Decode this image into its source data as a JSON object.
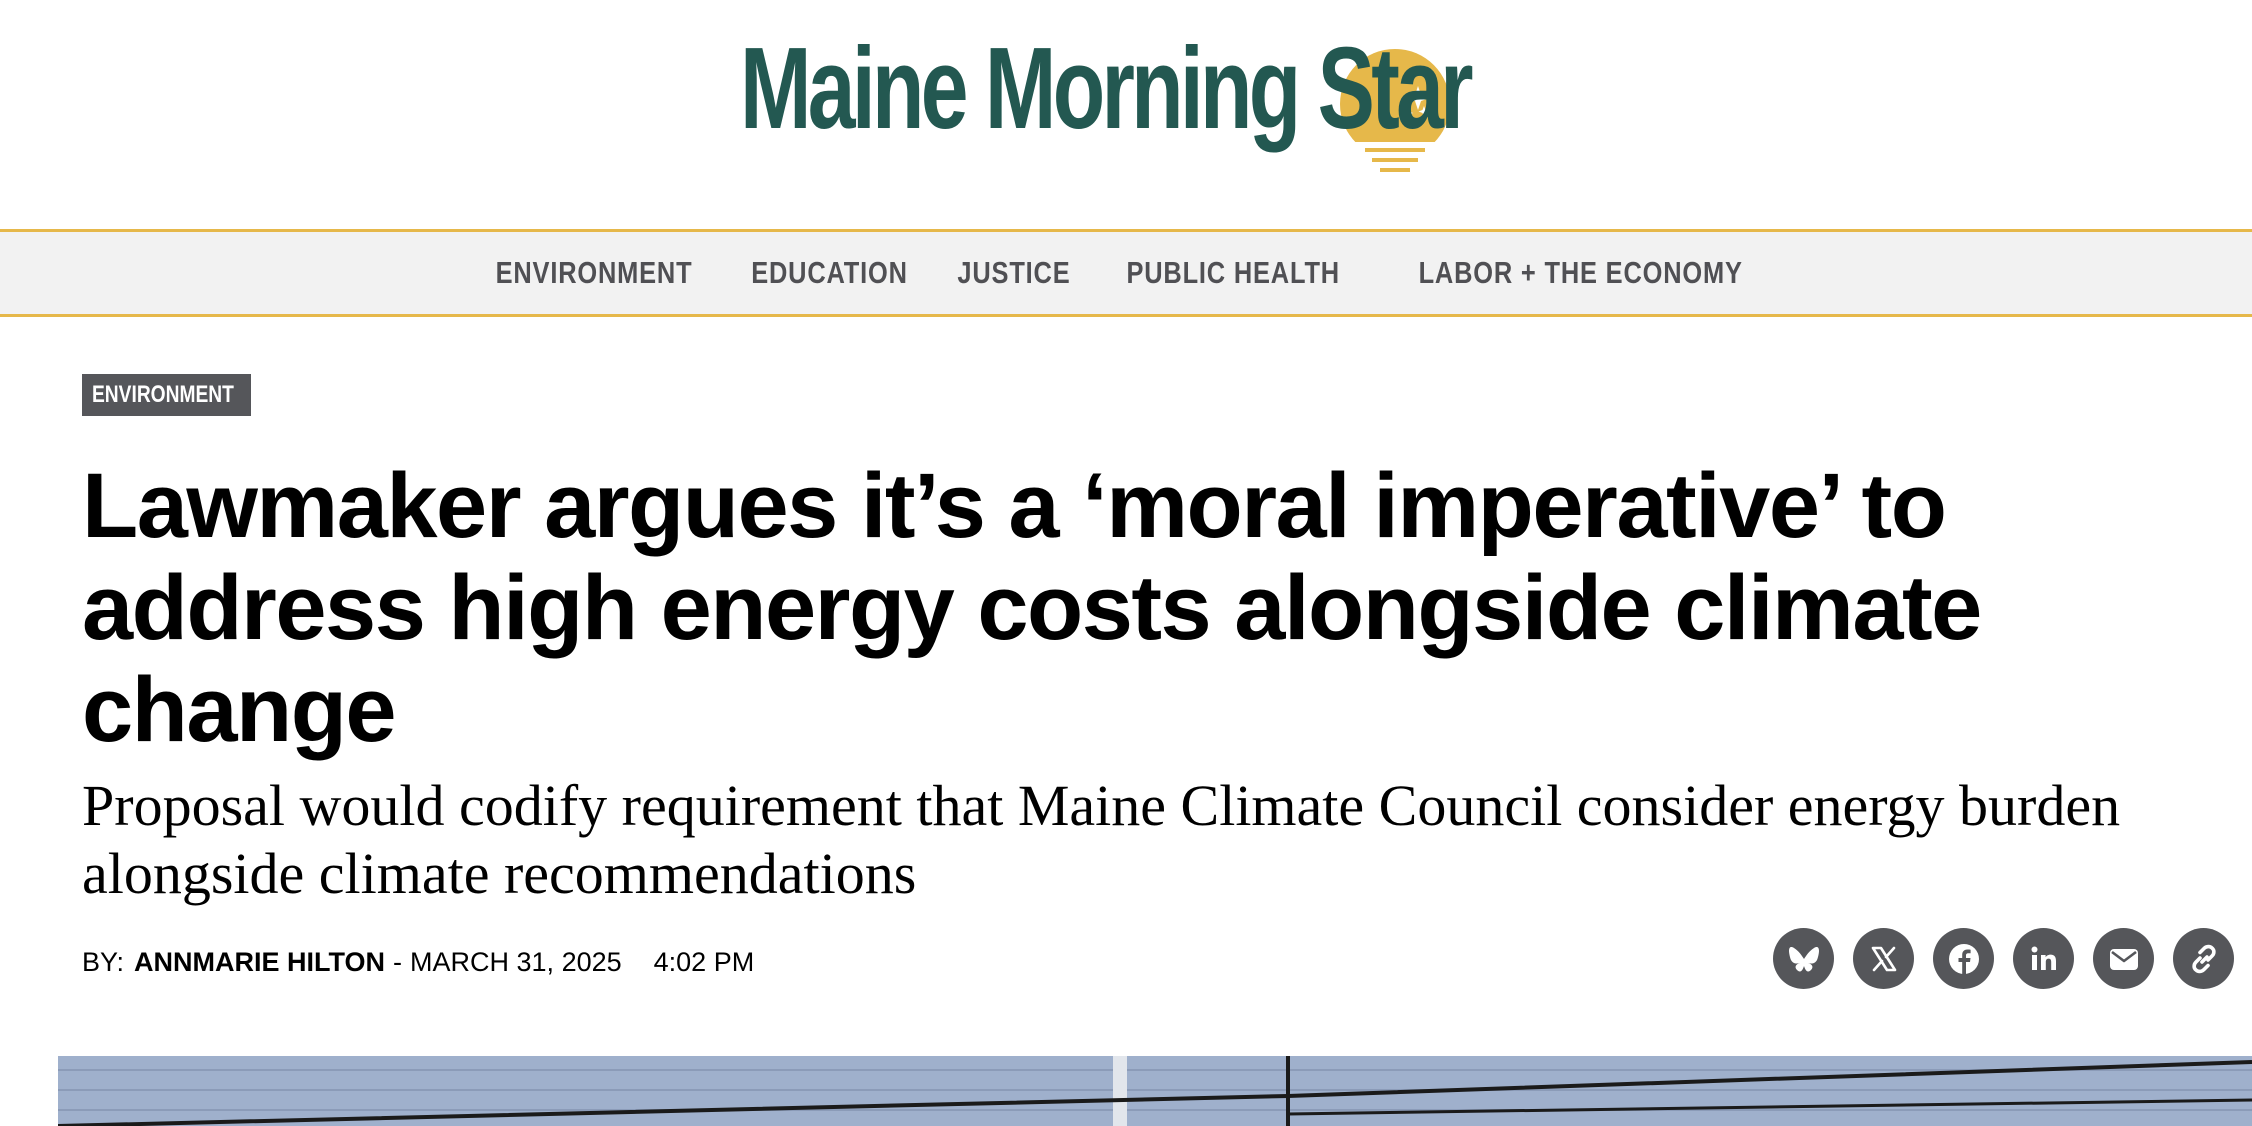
{
  "masthead": {
    "logo_text": "Maine Morning Star",
    "logo_text_color": "#235851",
    "logo_sun_color": "#e6b84a"
  },
  "nav": {
    "items": [
      {
        "label": "ENVIRONMENT"
      },
      {
        "label": "EDUCATION"
      },
      {
        "label": "JUSTICE"
      },
      {
        "label": "PUBLIC HEALTH"
      },
      {
        "label": "LABOR + THE ECONOMY"
      }
    ],
    "border_color": "#e6b84a"
  },
  "article": {
    "category": "ENVIRONMENT",
    "headline": "Lawmaker argues it’s a ‘moral imperative’ to address high energy costs alongside climate change",
    "subheadline": "Proposal would codify requirement that Maine Climate Council consider energy burden alongside climate recommendations",
    "byline": {
      "by_label": "BY:",
      "author": "ANNMARIE HILTON",
      "separator": "-",
      "date": "MARCH 31, 2025",
      "time": "4:02 PM"
    }
  },
  "share": {
    "buttons": [
      {
        "icon": "bluesky-icon"
      },
      {
        "icon": "x-icon"
      },
      {
        "icon": "facebook-icon"
      },
      {
        "icon": "linkedin-icon"
      },
      {
        "icon": "email-icon"
      },
      {
        "icon": "link-icon"
      }
    ],
    "button_color": "#55565a"
  }
}
